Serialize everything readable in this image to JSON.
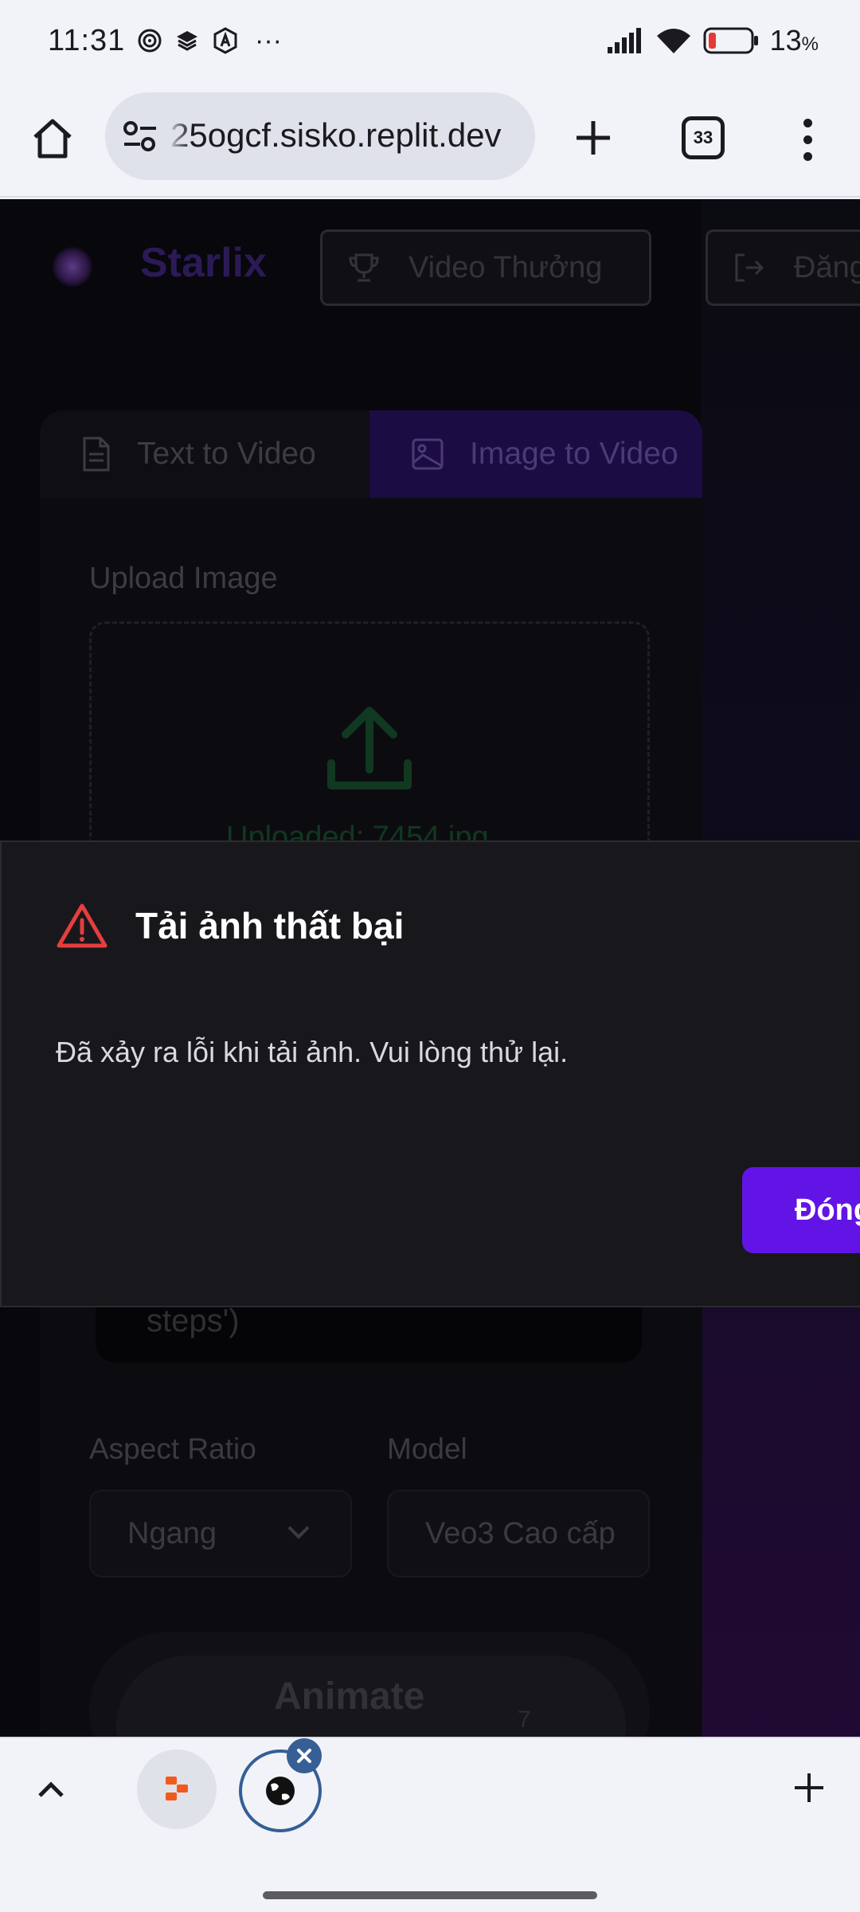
{
  "status_bar": {
    "time": "11:31",
    "more_indicator": "···",
    "battery_percent": "13",
    "battery_unit": "%",
    "battery_color": "#e53935"
  },
  "browser": {
    "url": "25ogcf.sisko.replit.dev",
    "tab_count": "33",
    "icons": [
      "home-icon",
      "site-settings-icon",
      "new-tab-icon",
      "tab-switcher-icon",
      "more-menu-icon"
    ]
  },
  "page": {
    "brand": "Starlix",
    "header_buttons": {
      "video": "Video Thưởng",
      "login": "Đăng"
    },
    "tabs": {
      "text_to_video": "Text to Video",
      "image_to_video": "Image to Video"
    },
    "upload": {
      "label": "Upload Image",
      "status": "Uploaded: 7454.jpg"
    },
    "steps_fragment": "steps')",
    "aspect_ratio": {
      "label": "Aspect Ratio",
      "value": "Ngang"
    },
    "model": {
      "label": "Model",
      "value": "Veo3 Cao cấp"
    },
    "animate_button": {
      "label": "Animate",
      "count": "7"
    },
    "accent_color": "#6214e6"
  },
  "modal": {
    "title": "Tải ảnh thất bại",
    "message": "Đã xảy ra lỗi khi tải ảnh. Vui lòng thử lại.",
    "close_button": "Đóng",
    "warning_color": "#e53e3e"
  },
  "tab_strip": {
    "tabs": [
      "tab-thumbnail-app",
      "tab-thumbnail-web-active"
    ]
  }
}
